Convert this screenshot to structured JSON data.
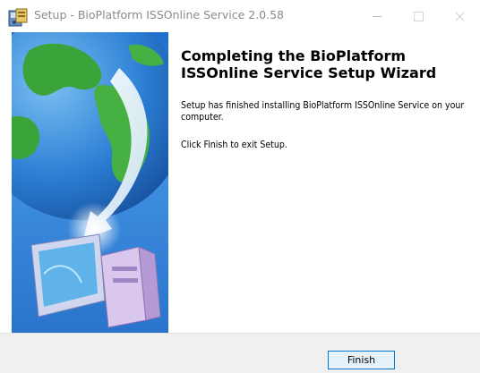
{
  "window": {
    "title": "Setup - BioPlatform ISSOnline Service 2.0.58",
    "app_icon": "installer-icon",
    "controls": {
      "minimize": "minimize-icon",
      "maximize": "maximize-icon",
      "close": "close-icon"
    }
  },
  "wizard": {
    "heading": "Completing the BioPlatform ISSOnline Service Setup Wizard",
    "paragraphs": [
      "Setup has finished installing BioPlatform ISSOnline Service on your computer.",
      "Click Finish to exit Setup."
    ],
    "banner_image": "globe-computer-banner"
  },
  "buttons": {
    "finish": "Finish"
  },
  "colors": {
    "accent": "#0078d7",
    "banner_sky": "#2f7ed2",
    "button_bg": "#e5f1fb",
    "footer_bg": "#f0f0f0"
  }
}
